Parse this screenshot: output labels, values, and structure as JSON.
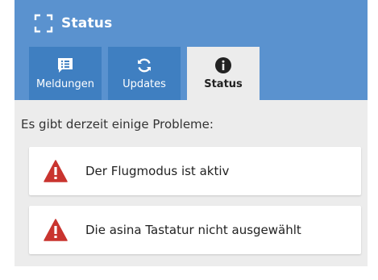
{
  "app": {
    "title": "Status",
    "header_color": "#5a92cf"
  },
  "tabs": [
    {
      "label": "Meldungen",
      "icon": "message-list-icon",
      "active": false
    },
    {
      "label": "Updates",
      "icon": "refresh-icon",
      "active": false
    },
    {
      "label": "Status",
      "icon": "info-icon",
      "active": true
    }
  ],
  "main": {
    "intro": "Es gibt derzeit einige Probleme:",
    "issues": [
      {
        "text": "Der Flugmodus ist aktiv",
        "icon": "warning-icon"
      },
      {
        "text": "Die asina Tastatur nicht ausgewählt",
        "icon": "warning-icon"
      }
    ],
    "warning_color": "#c9342f"
  }
}
